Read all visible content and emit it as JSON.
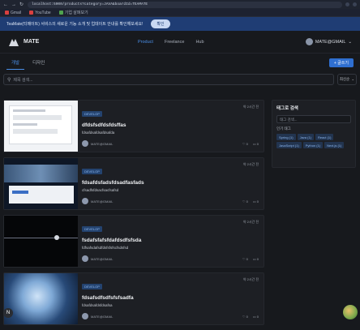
{
  "browser": {
    "url": "localhost:5000/products?category=JAVA&boardId=TEAMATE",
    "bookmarks": [
      "Gmail",
      "YouTube",
      "기업 살펴보기"
    ]
  },
  "banner": {
    "text": "TeaMate(티메이트) 서비스의 새로운 기능 소개 및 업데이트 안내를 확인해보세요!",
    "button": "확인"
  },
  "header": {
    "brand": "MATE",
    "nav": [
      "Product",
      "Freelance",
      "Hub"
    ],
    "user": "MATE@GMAIL"
  },
  "tabs": [
    "개발",
    "디자인"
  ],
  "write_button": "+ 글쓰기",
  "search": {
    "placeholder": "제목 검색...",
    "sort": "최신순"
  },
  "posts": [
    {
      "badge": "DEVELOP",
      "date": "약 2시간 전",
      "title": "dfdsfsdfdsfdsffas",
      "desc": "fdsafdsafdsafdsafda",
      "author": "MATE@GMAIL",
      "likes": "0",
      "comments": "0"
    },
    {
      "badge": "DEVELOP",
      "date": "약 2시간 전",
      "title": "fdsafdsfadsfdsadfasfads",
      "desc": "cfsadfsfdsacfsacfsafsd",
      "author": "MATE@GMAIL",
      "likes": "0",
      "comments": "0"
    },
    {
      "badge": "DEVELOP",
      "date": "약 2시간 전",
      "title": "fsdafsfafsfdafdsdfsfsda",
      "desc": "fdfsafsdafsdfdsfsfsfscfsdsfsd",
      "author": "MATE@GMAIL",
      "likes": "0",
      "comments": "0"
    },
    {
      "badge": "DEVELOP",
      "date": "약 2시간 전",
      "title": "fdsafsdfsdfsfsfsadfa",
      "desc": "fdsafdsafdsfdsafsa",
      "author": "MATE@GMAIL",
      "likes": "0",
      "comments": "0"
    }
  ],
  "sidebar": {
    "title": "태그로 검색",
    "filter_placeholder": "태그 검색...",
    "sub": "인기 태그",
    "tags": [
      "Spring (1)",
      "Java (1)",
      "React (1)",
      "JavaScript (1)",
      "Python (1)",
      "Next.js (1)"
    ]
  },
  "colors": {
    "accent": "#2f6fd0",
    "banner": "#1f3d74",
    "background": "#17191d"
  }
}
